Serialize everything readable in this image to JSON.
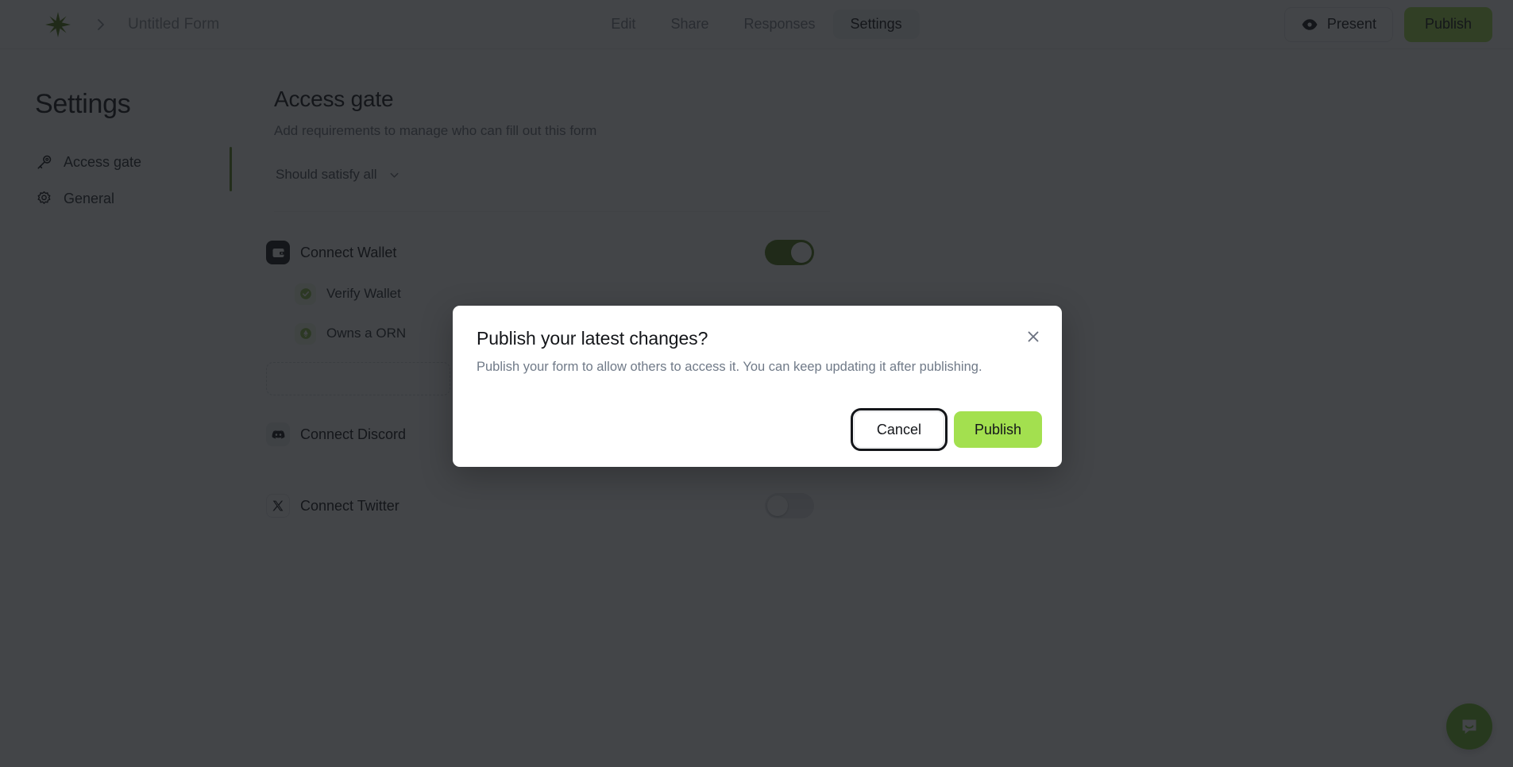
{
  "topbar": {
    "logo_icon": "sparkle-star-icon",
    "breadcrumb_chevron_icon": "chevron-right-icon",
    "form_title": "Untitled Form",
    "tabs": [
      {
        "label": "Edit",
        "active": false
      },
      {
        "label": "Share",
        "active": false
      },
      {
        "label": "Responses",
        "active": false
      },
      {
        "label": "Settings",
        "active": true
      }
    ],
    "present_label": "Present",
    "present_icon": "eye-icon",
    "publish_label": "Publish",
    "publish_color": "#a3e04f"
  },
  "sidebar": {
    "heading": "Settings",
    "items": [
      {
        "label": "Access gate",
        "icon": "key-icon",
        "active": true
      },
      {
        "label": "General",
        "icon": "gear-icon",
        "active": false
      }
    ],
    "active_indicator_color": "#5f8a21"
  },
  "main": {
    "title": "Access gate",
    "subtitle": "Add requirements to manage who can fill out this form",
    "match_mode": {
      "label": "Should satisfy all",
      "chevron_icon": "chevron-down-icon"
    },
    "requirements": [
      {
        "label": "Connect Wallet",
        "icon": "wallet-icon",
        "enabled": true,
        "toggle_state": "on",
        "children": [
          {
            "label": "Verify Wallet",
            "icon": "check-badge-icon"
          },
          {
            "label": "Owns a ORN",
            "icon": "token-badge-icon"
          }
        ]
      },
      {
        "label": "Connect Discord",
        "icon": "discord-icon",
        "enabled": false,
        "toggle_state": "off",
        "children": []
      },
      {
        "label": "Connect Twitter",
        "icon": "x-twitter-icon",
        "enabled": false,
        "toggle_state": "off",
        "children": []
      }
    ],
    "add_requirement_label": ""
  },
  "dialog": {
    "title": "Publish your latest changes?",
    "description": "Publish your form to allow others to access it. You can keep updating it after publishing.",
    "close_icon": "close-icon",
    "cancel_label": "Cancel",
    "publish_label": "Publish",
    "publish_color": "#a3e04f",
    "focused_button": "Cancel"
  },
  "chat_launcher": {
    "icon": "chat-bubble-icon",
    "color": "#76c32e"
  }
}
